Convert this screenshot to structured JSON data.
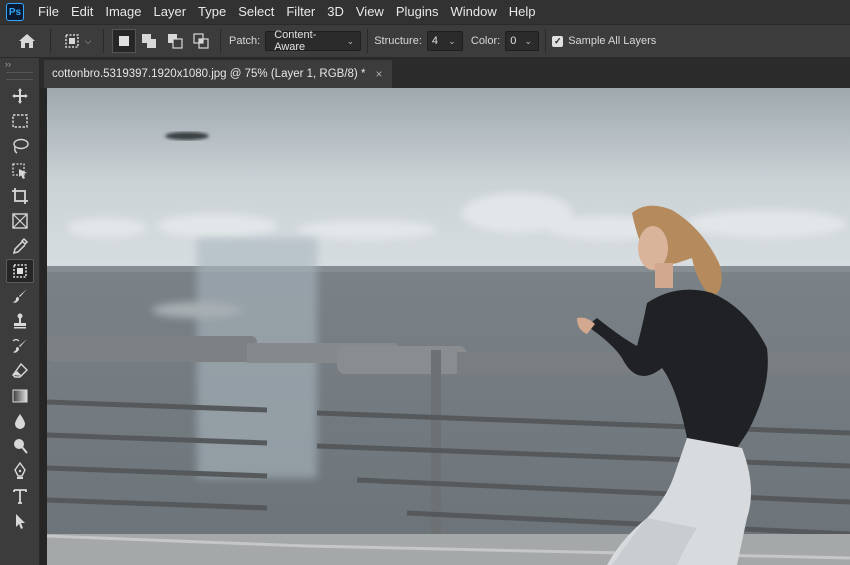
{
  "menubar": {
    "logo": "Ps",
    "items": [
      "File",
      "Edit",
      "Image",
      "Layer",
      "Type",
      "Select",
      "Filter",
      "3D",
      "View",
      "Plugins",
      "Window",
      "Help"
    ]
  },
  "options": {
    "patch_label": "Patch:",
    "patch_value": "Content-Aware",
    "structure_label": "Structure:",
    "structure_value": "4",
    "color_label": "Color:",
    "color_value": "0",
    "sample_all_layers_label": "Sample All Layers",
    "sample_all_layers_checked": true
  },
  "toolbar": {
    "collapse": "››",
    "tools": [
      "move-icon",
      "marquee-icon",
      "lasso-icon",
      "object-select-icon",
      "crop-icon",
      "frame-icon",
      "eyedropper-icon",
      "patch-icon",
      "brush-icon",
      "stamp-icon",
      "history-brush-icon",
      "eraser-icon",
      "gradient-icon",
      "blur-icon",
      "dodge-icon",
      "pen-icon",
      "type-icon",
      "path-select-icon"
    ],
    "active_tool": "patch-icon"
  },
  "document": {
    "tab_title": "cottonbro.5319397.1920x1080.jpg @ 75% (Layer 1, RGB/8) *",
    "close": "×"
  },
  "colors": {
    "accent": "#31a8ff",
    "panel": "#3c3c3c",
    "menubar": "#323232"
  }
}
